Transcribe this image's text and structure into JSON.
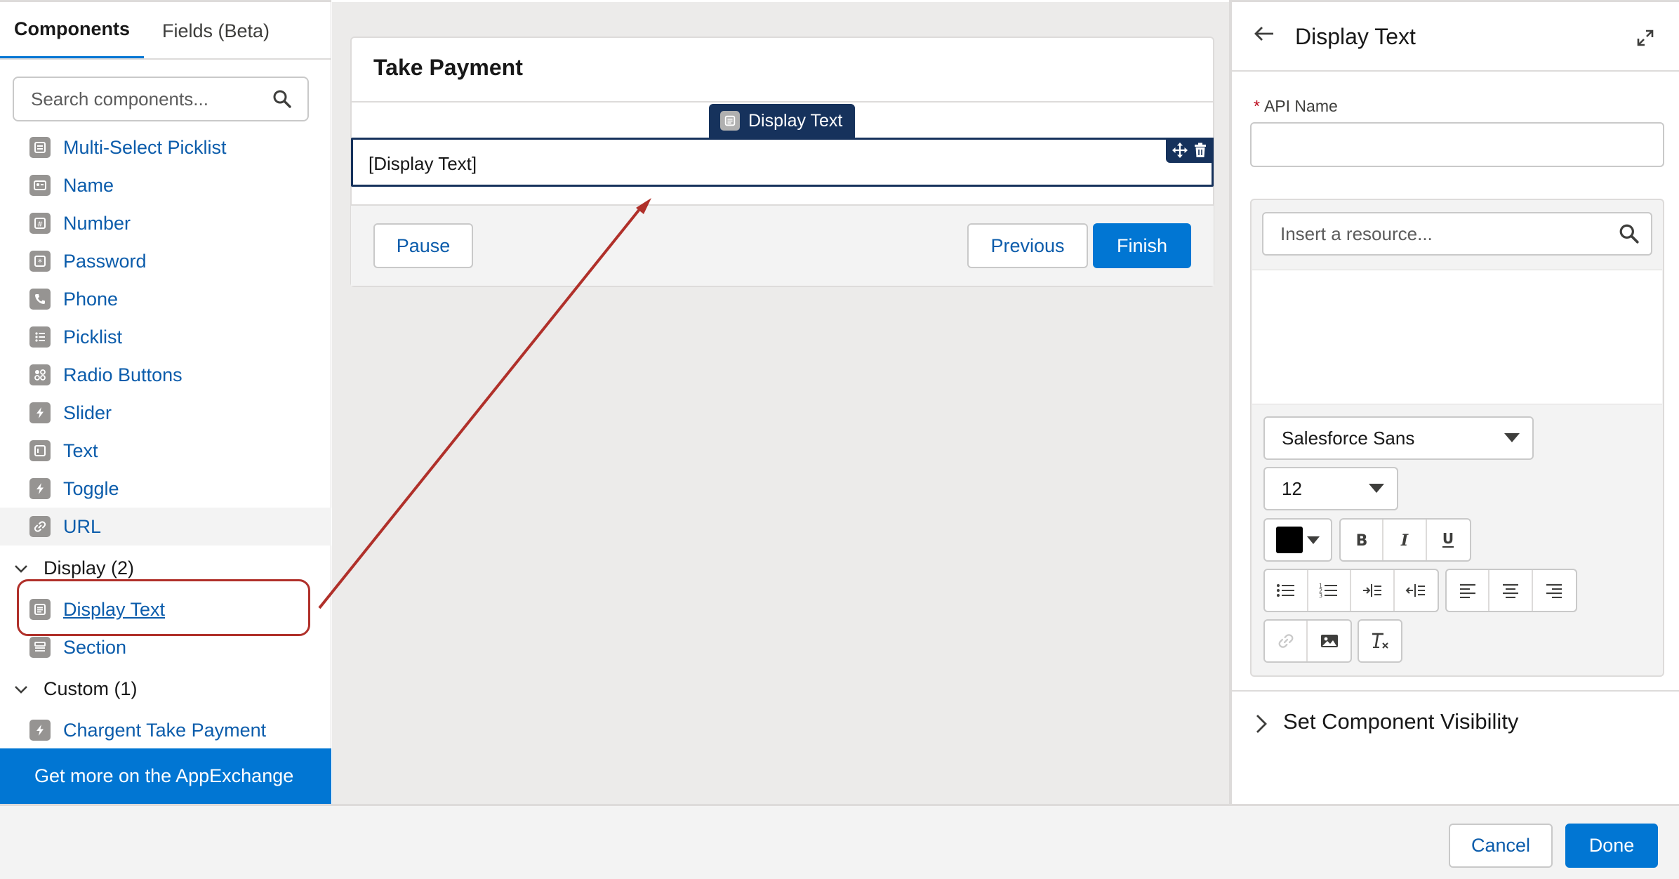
{
  "left_panel": {
    "tabs": [
      {
        "label": "Components"
      },
      {
        "label": "Fields (Beta)"
      }
    ],
    "search_placeholder": "Search components...",
    "items": [
      {
        "label": "Multi-Select Picklist",
        "icon": "multi-select-icon"
      },
      {
        "label": "Name",
        "icon": "name-card-icon"
      },
      {
        "label": "Number",
        "icon": "number-icon"
      },
      {
        "label": "Password",
        "icon": "password-icon"
      },
      {
        "label": "Phone",
        "icon": "phone-icon"
      },
      {
        "label": "Picklist",
        "icon": "picklist-icon"
      },
      {
        "label": "Radio Buttons",
        "icon": "radio-buttons-icon"
      },
      {
        "label": "Slider",
        "icon": "lightning-icon"
      },
      {
        "label": "Text",
        "icon": "text-icon"
      },
      {
        "label": "Toggle",
        "icon": "lightning-icon"
      },
      {
        "label": "URL",
        "icon": "link-icon"
      }
    ],
    "sections": {
      "display": {
        "label": "Display (2)",
        "items": [
          {
            "label": "Display Text",
            "icon": "display-text-icon"
          },
          {
            "label": "Section",
            "icon": "section-icon"
          }
        ]
      },
      "custom": {
        "label": "Custom (1)",
        "items": [
          {
            "label": "Chargent Take Payment",
            "icon": "lightning-icon"
          }
        ]
      }
    },
    "appexchange_label": "Get more on the AppExchange"
  },
  "canvas": {
    "screen_title": "Take Payment",
    "drag_tag_label": "Display Text",
    "field_placeholder": "[Display Text]",
    "buttons": {
      "pause": "Pause",
      "previous": "Previous",
      "finish": "Finish"
    }
  },
  "right_panel": {
    "title": "Display Text",
    "api_name_label": "API Name",
    "api_name_value": "",
    "resource_placeholder": "Insert a resource...",
    "font_family": "Salesforce Sans",
    "font_size": "12",
    "text_color": "#000000",
    "visibility_label": "Set Component Visibility"
  },
  "footer": {
    "cancel": "Cancel",
    "done": "Done"
  },
  "colors": {
    "brand": "#0176d3",
    "link": "#0b5cab",
    "selected_border": "#16325c",
    "annotation": "#b0302a"
  }
}
